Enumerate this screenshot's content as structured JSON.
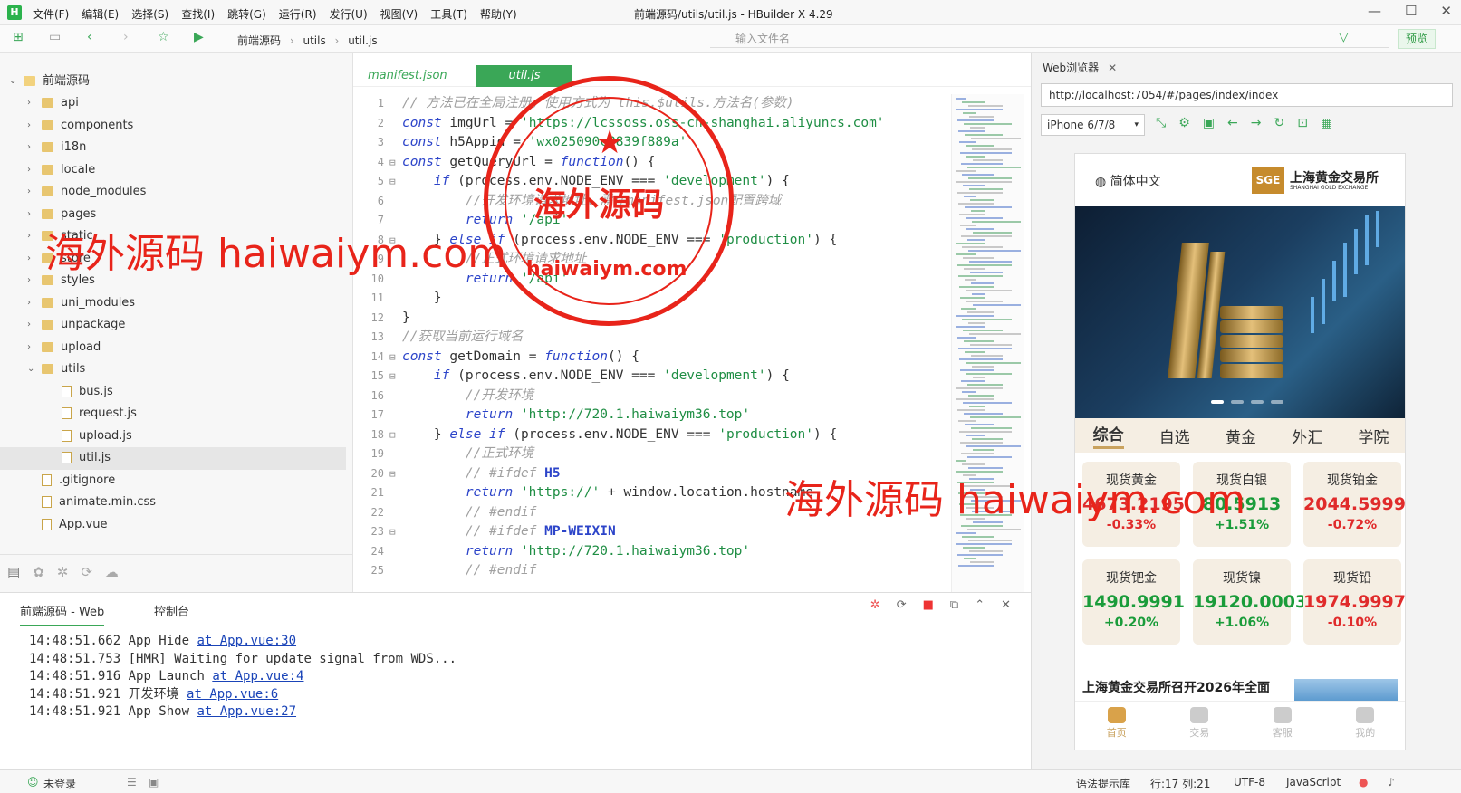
{
  "window": {
    "logo": "H",
    "title": "前端源码/utils/util.js - HBuilder X 4.29",
    "menu": [
      "文件(F)",
      "编辑(E)",
      "选择(S)",
      "查找(I)",
      "跳转(G)",
      "运行(R)",
      "发行(U)",
      "视图(V)",
      "工具(T)",
      "帮助(Y)"
    ]
  },
  "toolbar": {
    "breadcrumb": [
      "前端源码",
      "utils",
      "util.js"
    ],
    "file_search_placeholder": "输入文件名",
    "preview_label": "预览"
  },
  "explorer": {
    "root": "前端源码",
    "items": [
      {
        "label": "api",
        "type": "folder",
        "level": 1
      },
      {
        "label": "components",
        "type": "folder",
        "level": 1
      },
      {
        "label": "i18n",
        "type": "folder",
        "level": 1
      },
      {
        "label": "locale",
        "type": "folder",
        "level": 1
      },
      {
        "label": "node_modules",
        "type": "folder",
        "level": 1
      },
      {
        "label": "pages",
        "type": "folder",
        "level": 1
      },
      {
        "label": "static",
        "type": "folder",
        "level": 1
      },
      {
        "label": "store",
        "type": "folder",
        "level": 1
      },
      {
        "label": "styles",
        "type": "folder",
        "level": 1
      },
      {
        "label": "uni_modules",
        "type": "folder",
        "level": 1
      },
      {
        "label": "unpackage",
        "type": "folder",
        "level": 1
      },
      {
        "label": "upload",
        "type": "folder",
        "level": 1
      },
      {
        "label": "utils",
        "type": "folder-open",
        "level": 1
      },
      {
        "label": "bus.js",
        "type": "file",
        "level": 2
      },
      {
        "label": "request.js",
        "type": "file",
        "level": 2
      },
      {
        "label": "upload.js",
        "type": "file",
        "level": 2
      },
      {
        "label": "util.js",
        "type": "file",
        "level": 2,
        "selected": true
      },
      {
        "label": ".gitignore",
        "type": "file",
        "level": 1
      },
      {
        "label": "animate.min.css",
        "type": "file",
        "level": 1
      },
      {
        "label": "App.vue",
        "type": "file",
        "level": 1
      }
    ]
  },
  "editor": {
    "tabs": [
      "manifest.json",
      "util.js"
    ],
    "active_tab": "util.js",
    "lines": [
      {
        "n": "1",
        "fold": "",
        "segs": [
          [
            "c-cm",
            "// 方法已在全局注册，使用方式为 this.$utils.方法名(参数)"
          ]
        ]
      },
      {
        "n": "2",
        "fold": "",
        "segs": [
          [
            "c-kw",
            "const "
          ],
          [
            "c-id",
            "imgUrl = "
          ],
          [
            "c-st",
            "'https://lcssoss.oss-cn-shanghai.aliyuncs.com'"
          ]
        ]
      },
      {
        "n": "3",
        "fold": "",
        "segs": [
          [
            "c-kw",
            "const "
          ],
          [
            "c-id",
            "h5Appid = "
          ],
          [
            "c-st",
            "'wx025090c8839f889a'"
          ]
        ]
      },
      {
        "n": "4",
        "fold": "⊟",
        "segs": [
          [
            "c-kw",
            "const "
          ],
          [
            "c-id",
            "getQueryUrl = "
          ],
          [
            "c-fn",
            "function"
          ],
          [
            "c-id",
            "() {"
          ]
        ]
      },
      {
        "n": "5",
        "fold": "⊟",
        "segs": [
          [
            "c-id",
            "    "
          ],
          [
            "c-kw",
            "if "
          ],
          [
            "c-id",
            "(process.env.NODE_ENV === "
          ],
          [
            "c-st",
            "'development'"
          ],
          [
            "c-id",
            ") {"
          ]
        ]
      },
      {
        "n": "6",
        "fold": "",
        "segs": [
          [
            "c-cm",
            "        //开发环境请求地址，需在manifest.json配置跨域"
          ]
        ]
      },
      {
        "n": "7",
        "fold": "",
        "segs": [
          [
            "c-id",
            "        "
          ],
          [
            "c-kw",
            "return "
          ],
          [
            "c-st",
            "'/api'"
          ]
        ]
      },
      {
        "n": "8",
        "fold": "⊟",
        "segs": [
          [
            "c-id",
            "    } "
          ],
          [
            "c-kw",
            "else if "
          ],
          [
            "c-id",
            "(process.env.NODE_ENV === "
          ],
          [
            "c-st",
            "'production'"
          ],
          [
            "c-id",
            ") {"
          ]
        ]
      },
      {
        "n": "9",
        "fold": "",
        "segs": [
          [
            "c-cm",
            "        //正式环境请求地址"
          ]
        ]
      },
      {
        "n": "10",
        "fold": "",
        "segs": [
          [
            "c-id",
            "        "
          ],
          [
            "c-kw",
            "return "
          ],
          [
            "c-st",
            "'/api'"
          ]
        ]
      },
      {
        "n": "11",
        "fold": "",
        "segs": [
          [
            "c-id",
            "    }"
          ]
        ]
      },
      {
        "n": "12",
        "fold": "",
        "segs": [
          [
            "c-id",
            "}"
          ]
        ]
      },
      {
        "n": "13",
        "fold": "",
        "segs": [
          [
            "c-cm",
            "//获取当前运行域名"
          ]
        ]
      },
      {
        "n": "14",
        "fold": "⊟",
        "segs": [
          [
            "c-kw",
            "const "
          ],
          [
            "c-id",
            "getDomain = "
          ],
          [
            "c-fn",
            "function"
          ],
          [
            "c-id",
            "() {"
          ]
        ]
      },
      {
        "n": "15",
        "fold": "⊟",
        "segs": [
          [
            "c-id",
            "    "
          ],
          [
            "c-kw",
            "if "
          ],
          [
            "c-id",
            "(process.env.NODE_ENV === "
          ],
          [
            "c-st",
            "'development'"
          ],
          [
            "c-id",
            ") {"
          ]
        ]
      },
      {
        "n": "16",
        "fold": "",
        "segs": [
          [
            "c-cm",
            "        //开发环境"
          ]
        ]
      },
      {
        "n": "17",
        "fold": "",
        "segs": [
          [
            "c-id",
            "        "
          ],
          [
            "c-kw",
            "return "
          ],
          [
            "c-st",
            "'http://720.1.haiwaiym36.top'"
          ]
        ]
      },
      {
        "n": "18",
        "fold": "⊟",
        "segs": [
          [
            "c-id",
            "    } "
          ],
          [
            "c-kw",
            "else if "
          ],
          [
            "c-id",
            "(process.env.NODE_ENV === "
          ],
          [
            "c-st",
            "'production'"
          ],
          [
            "c-id",
            ") {"
          ]
        ]
      },
      {
        "n": "19",
        "fold": "",
        "segs": [
          [
            "c-cm",
            "        //正式环境"
          ]
        ]
      },
      {
        "n": "20",
        "fold": "⊟",
        "segs": [
          [
            "c-cm",
            "        // #ifdef "
          ],
          [
            "c-pp",
            "H5"
          ]
        ]
      },
      {
        "n": "21",
        "fold": "",
        "segs": [
          [
            "c-id",
            "        "
          ],
          [
            "c-kw",
            "return "
          ],
          [
            "c-st",
            "'https://'"
          ],
          [
            "c-id",
            " + window.location.hostname"
          ]
        ]
      },
      {
        "n": "22",
        "fold": "",
        "segs": [
          [
            "c-cm",
            "        // #endif"
          ]
        ]
      },
      {
        "n": "23",
        "fold": "⊟",
        "segs": [
          [
            "c-cm",
            "        // #ifdef "
          ],
          [
            "c-pp",
            "MP-WEIXIN"
          ]
        ]
      },
      {
        "n": "24",
        "fold": "",
        "segs": [
          [
            "c-id",
            "        "
          ],
          [
            "c-kw",
            "return "
          ],
          [
            "c-st",
            "'http://720.1.haiwaiym36.top'"
          ]
        ]
      },
      {
        "n": "25",
        "fold": "",
        "segs": [
          [
            "c-cm",
            "        // #endif"
          ]
        ]
      }
    ]
  },
  "console": {
    "tabs": [
      "前端源码 - Web",
      "控制台"
    ],
    "logs": [
      {
        "time": "14:48:51.662",
        "msg": "App Hide ",
        "link": "at App.vue:30"
      },
      {
        "time": "14:48:51.753",
        "msg": "[HMR] Waiting for update signal from WDS...",
        "link": ""
      },
      {
        "time": "14:48:51.916",
        "msg": "App Launch ",
        "link": "at App.vue:4"
      },
      {
        "time": "14:48:51.921",
        "msg": "开发环境 ",
        "link": "at App.vue:6"
      },
      {
        "time": "14:48:51.921",
        "msg": "App Show ",
        "link": "at App.vue:27"
      }
    ]
  },
  "status": {
    "login": "未登录",
    "hint": "语法提示库",
    "position": "行:17  列:21",
    "encoding": "UTF-8",
    "language": "JavaScript"
  },
  "browser": {
    "tab_title": "Web浏览器",
    "url": "http://localhost:7054/#/pages/index/index",
    "device": "iPhone 6/7/8",
    "app": {
      "language": "简体中文",
      "brand_logo": "SGE",
      "brand_cn": "上海黄金交易所",
      "brand_en": "SHANGHAI GOLD EXCHANGE",
      "categories": [
        "综合",
        "自选",
        "黄金",
        "外汇",
        "学院"
      ],
      "active_category": "综合",
      "quotes": [
        {
          "name": "现货黄金",
          "price": "4673.2195",
          "change": "-0.33%",
          "color": "#e02b2b"
        },
        {
          "name": "现货白银",
          "price": "80.5913",
          "change": "+1.51%",
          "color": "#1a9c3a"
        },
        {
          "name": "现货铂金",
          "price": "2044.5999",
          "change": "-0.72%",
          "color": "#e02b2b"
        },
        {
          "name": "现货钯金",
          "price": "1490.9991",
          "change": "+0.20%",
          "color": "#1a9c3a"
        },
        {
          "name": "现货镍",
          "price": "19120.0003",
          "change": "+1.06%",
          "color": "#1a9c3a"
        },
        {
          "name": "现货铅",
          "price": "1974.9997",
          "change": "-0.10%",
          "color": "#e02b2b"
        }
      ],
      "news_title": "上海黄金交易所召开2026年全面",
      "tabbar": [
        "首页",
        "交易",
        "客服",
        "我的"
      ]
    }
  },
  "watermarks": {
    "text": "海外源码 haiwaiym.com",
    "seal_cn": "海外源码",
    "seal_en": "haiwaiym.com"
  }
}
